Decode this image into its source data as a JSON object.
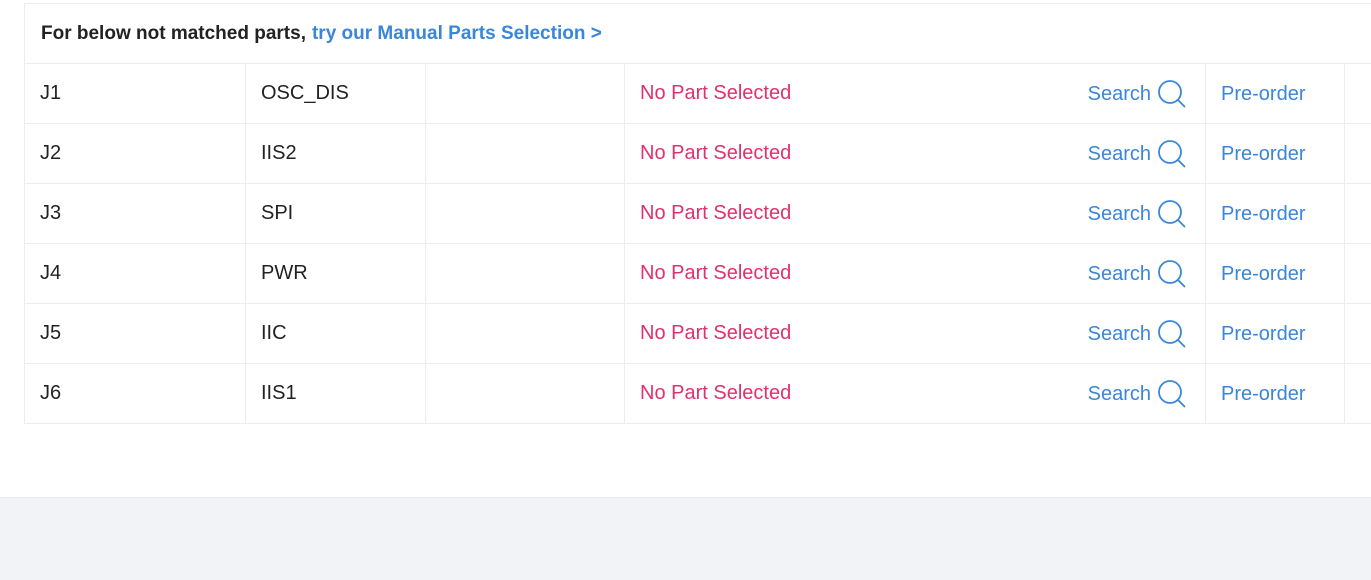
{
  "notice": {
    "text": "For below not matched parts,",
    "link": "try our Manual Parts Selection >"
  },
  "rows": [
    {
      "ref": "J1",
      "name": "OSC_DIS",
      "part_status": "No Part Selected",
      "search_label": "Search",
      "preorder_label": "Pre-order"
    },
    {
      "ref": "J2",
      "name": "IIS2",
      "part_status": "No Part Selected",
      "search_label": "Search",
      "preorder_label": "Pre-order"
    },
    {
      "ref": "J3",
      "name": "SPI",
      "part_status": "No Part Selected",
      "search_label": "Search",
      "preorder_label": "Pre-order"
    },
    {
      "ref": "J4",
      "name": "PWR",
      "part_status": "No Part Selected",
      "search_label": "Search",
      "preorder_label": "Pre-order"
    },
    {
      "ref": "J5",
      "name": "IIC",
      "part_status": "No Part Selected",
      "search_label": "Search",
      "preorder_label": "Pre-order"
    },
    {
      "ref": "J6",
      "name": "IIS1",
      "part_status": "No Part Selected",
      "search_label": "Search",
      "preorder_label": "Pre-order"
    }
  ],
  "icons": {
    "search": "search-icon"
  },
  "colors": {
    "link": "#3a86d8",
    "no_part": "#e0316e",
    "text": "#222222",
    "page_bg": "#f2f3f7"
  }
}
